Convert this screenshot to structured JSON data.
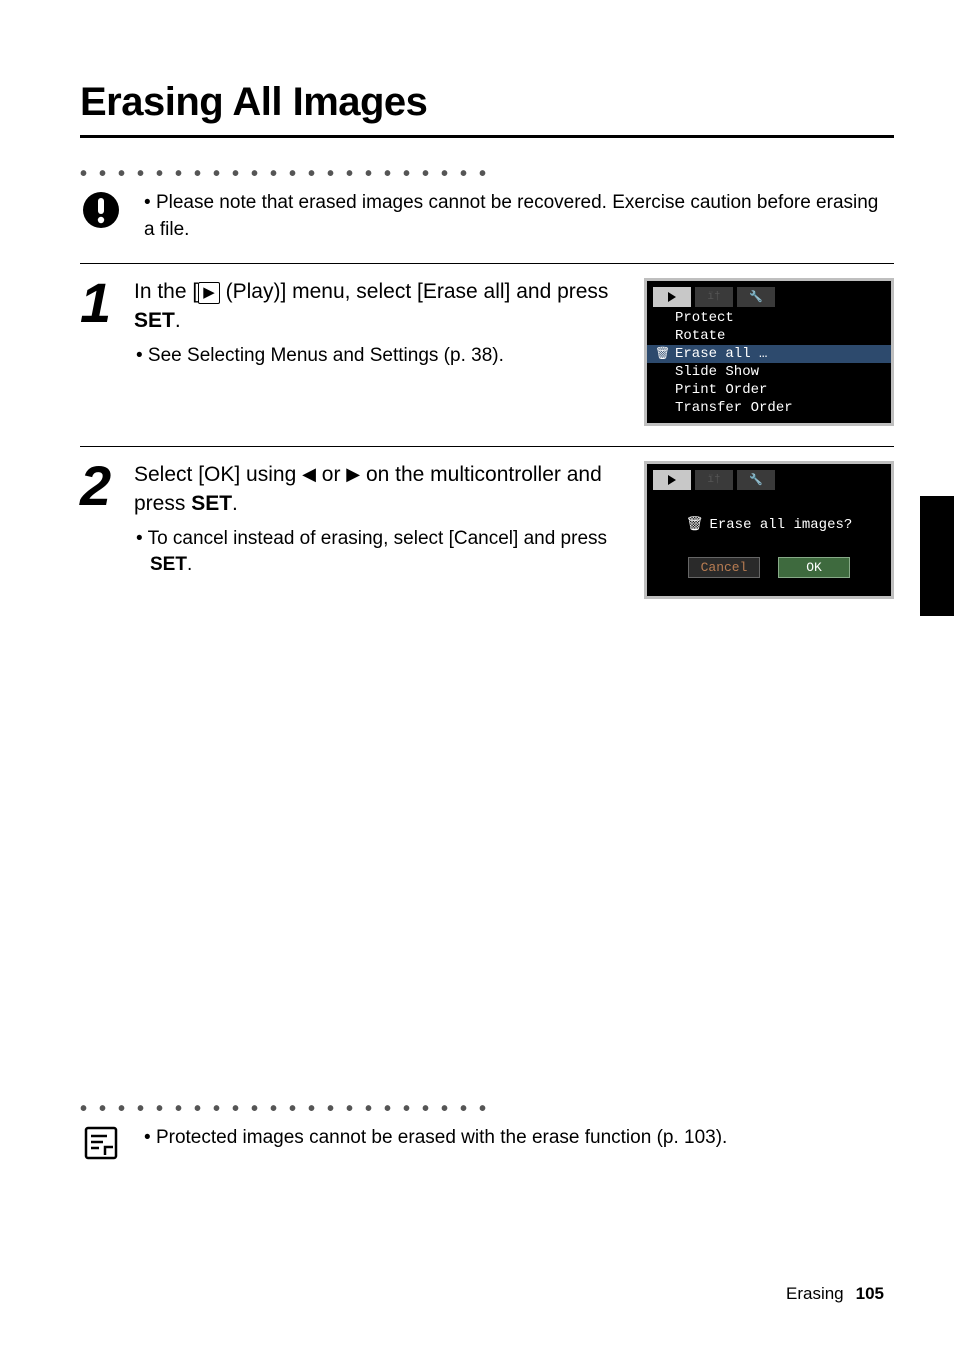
{
  "title": "Erasing All Images",
  "caution": "Please note that erased images cannot be recovered. Exercise caution before erasing a file.",
  "step1": {
    "heading_pre": "In the [",
    "heading_mid": " (Play)] menu, select [Erase all] and press ",
    "set": "SET",
    "period": ".",
    "sub": "• See Selecting Menus and Settings (p. 38)."
  },
  "step2": {
    "heading_pre": "Select [OK] using ",
    "heading_mid": " or ",
    "heading_post": " on the multicontroller and press ",
    "set": "SET",
    "period": ".",
    "sub_pre": "• To cancel instead of erasing, select [Cancel] and press ",
    "sub_set": "SET",
    "sub_post": "."
  },
  "screen1": {
    "items": [
      "Protect",
      "Rotate",
      "Erase all …",
      "Slide Show",
      "Print Order",
      "Transfer Order"
    ]
  },
  "screen2": {
    "prompt": "Erase all images?",
    "cancel": "Cancel",
    "ok": "OK"
  },
  "note": "Protected images cannot be erased with the erase function (p. 103).",
  "footer_section": "Erasing",
  "footer_page": "105"
}
